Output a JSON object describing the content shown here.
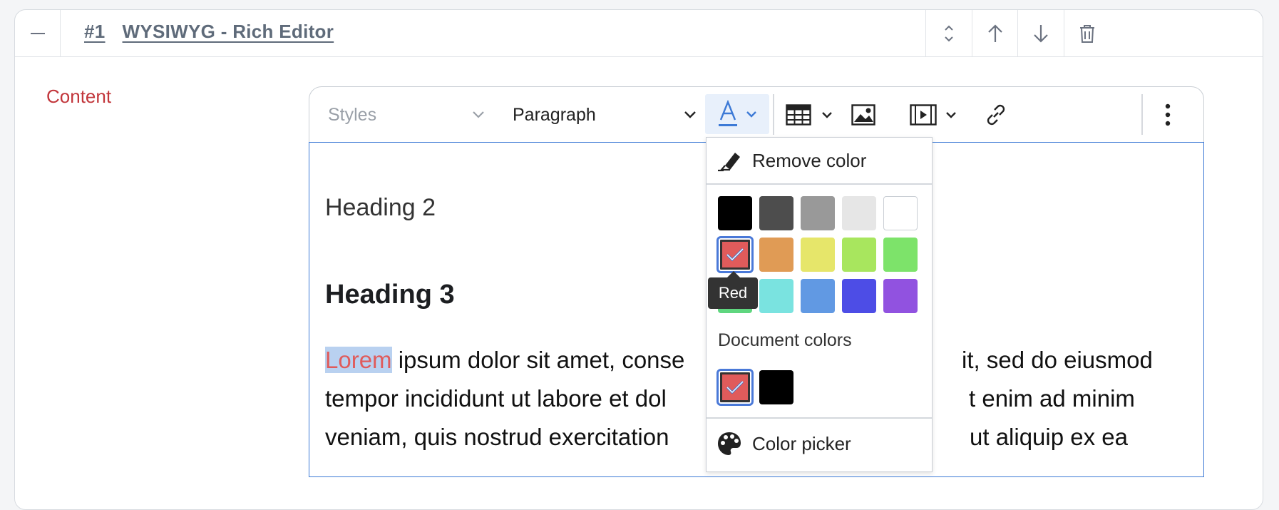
{
  "block": {
    "number": "#1",
    "name": "WYSIWYG - Rich Editor"
  },
  "field": {
    "label": "Content"
  },
  "toolbar": {
    "styles_placeholder": "Styles",
    "paragraph_label": "Paragraph"
  },
  "editor": {
    "heading2": "Heading 2",
    "heading3": "Heading 3",
    "selected_word": "Lorem",
    "lines": [
      " ipsum dolor sit amet, conse",
      "tempor incididunt ut labore et dol",
      "veniam, quis nostrud exercitation"
    ],
    "lines_right": [
      "it, sed do eiusmod",
      "t enim ad minim",
      "ut aliquip ex ea"
    ]
  },
  "color_panel": {
    "remove_label": "Remove color",
    "palette": [
      "#000000",
      "#4d4d4d",
      "#999999",
      "#e6e6e6",
      "#ffffff",
      "#e05b5b",
      "#e09b55",
      "#e6e66a",
      "#a8e65e",
      "#7de36a",
      "#5fd67f",
      "#7ae3e0",
      "#6199e3",
      "#4d4de6",
      "#9152e0"
    ],
    "selected_index": 5,
    "document_colors_label": "Document colors",
    "document_colors": [
      "#e05b5b",
      "#000000"
    ],
    "picker_label": "Color picker",
    "tooltip": "Red"
  },
  "colors": {
    "accent": "#3d7ad6",
    "label_red": "#c2363b"
  }
}
